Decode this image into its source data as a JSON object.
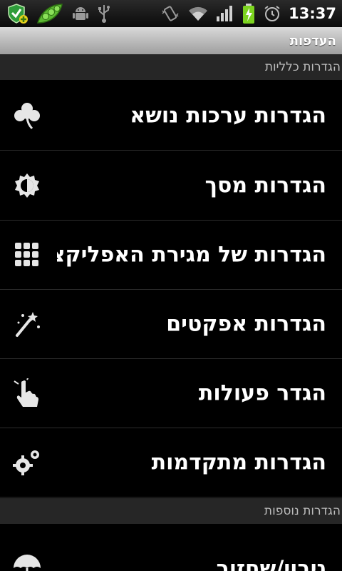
{
  "status_bar": {
    "time": "13:37",
    "icons_left": [
      "security-shield-icon",
      "pea-pod-icon",
      "android-debug-icon",
      "usb-icon"
    ],
    "icons_right": [
      "vibrate-icon",
      "wifi-icon",
      "signal-icon",
      "battery-charging-icon",
      "alarm-icon"
    ]
  },
  "title": "העדפות",
  "sections": [
    {
      "header": "הגדרות כלליות",
      "items": [
        {
          "label": "הגדרות ערכות נושא",
          "icon": "clover-icon"
        },
        {
          "label": "הגדרות מסך",
          "icon": "brightness-icon"
        },
        {
          "label": "הגדרות של מגירת האפליקציות",
          "icon": "grid-icon"
        },
        {
          "label": "הגדרות אפקטים",
          "icon": "magic-wand-icon"
        },
        {
          "label": "הגדר פעולות",
          "icon": "touch-gesture-icon"
        },
        {
          "label": "הגדרות מתקדמות",
          "icon": "gears-icon"
        }
      ]
    },
    {
      "header": "הגדרות נוספות",
      "items": [
        {
          "label": "גיבוי/שחזור",
          "icon": "umbrella-icon"
        }
      ]
    }
  ],
  "colors": {
    "background": "#000000",
    "title_bar": "#bdbdbd",
    "section_header": "#262626",
    "divider": "#2c2c2c"
  }
}
